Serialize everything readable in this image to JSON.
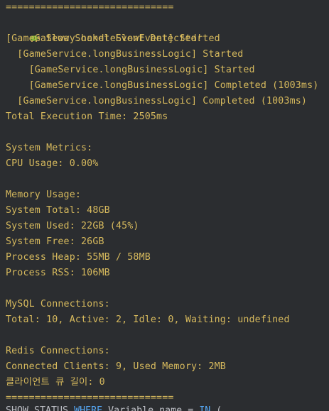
{
  "console": {
    "separator_top": "=============================",
    "slow_event_icon": "turtle-icon",
    "slow_event_title": "Slow Socket Event Detected!",
    "log_lines": [
      "[GameGateway.handleSlowEvent] Started",
      "  [GameService.longBusinessLogic] Started",
      "    [GameService.longBusinessLogic] Started",
      "    [GameService.longBusinessLogic] Completed (1003ms)",
      "  [GameService.longBusinessLogic] Completed (1003ms)",
      "Total Execution Time: 2505ms",
      "",
      "System Metrics:",
      "CPU Usage: 0.00%",
      "",
      "Memory Usage:",
      "System Total: 48GB",
      "System Used: 22GB (45%)",
      "System Free: 26GB",
      "Process Heap: 55MB / 58MB",
      "Process RSS: 106MB",
      "",
      "MySQL Connections:",
      "Total: 10, Active: 2, Idle: 0, Waiting: undefined",
      "",
      "Redis Connections:",
      "Connected Clients: 9, Used Memory: 2MB",
      "클라이언트 큐 길이: 0"
    ],
    "separator_bottom": "=============================",
    "cut_off_line": {
      "part1": "SHOW STATUS ",
      "part2": "WHERE",
      "part3": " Variable_name = ",
      "part4": "IN",
      "part5": " (..."
    },
    "colors": {
      "background": "#2b2d30",
      "log_text": "#d6b95d"
    }
  }
}
